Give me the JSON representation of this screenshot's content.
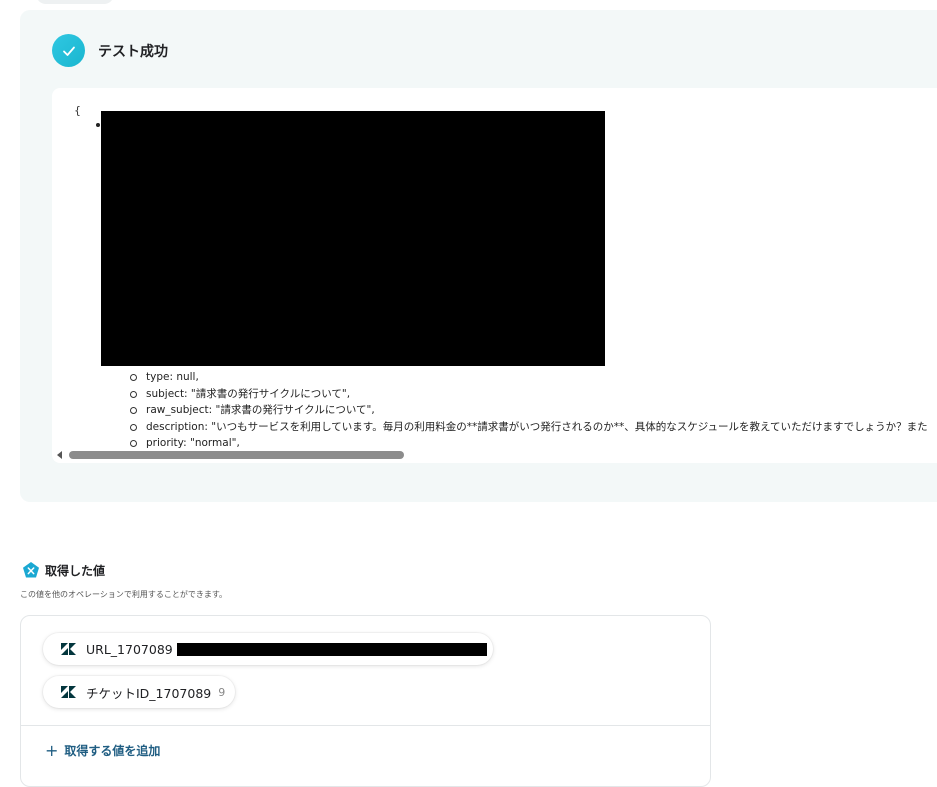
{
  "test_result": {
    "title": "テスト成功",
    "json_open": "{",
    "lines": [
      "type: null,",
      "subject: \"請求書の発行サイクルについて\",",
      "raw_subject: \"請求書の発行サイクルについて\",",
      "description: \"いつもサービスを利用しています。毎月の利用料金の**請求書がいつ発行されるのか**、具体的なスケジュールを教えていただけますでしょうか？また",
      "priority: \"normal\","
    ]
  },
  "retrieved_values": {
    "title": "取得した値",
    "description": "この値を他のオペレーションで利用することができます。",
    "items": [
      {
        "label": "URL_1707089",
        "value": "",
        "redacted": true
      },
      {
        "label": "チケットID_1707089",
        "value": "9",
        "redacted": false
      }
    ],
    "add_label": "取得する値を追加"
  },
  "icons": {
    "success": "check-icon",
    "values": "x-pentagon-icon",
    "service": "zendesk-icon",
    "add": "plus-icon"
  },
  "colors": {
    "accent": "#19b6cf",
    "link": "#1f5d82",
    "panel_bg": "#f3f8f8"
  }
}
